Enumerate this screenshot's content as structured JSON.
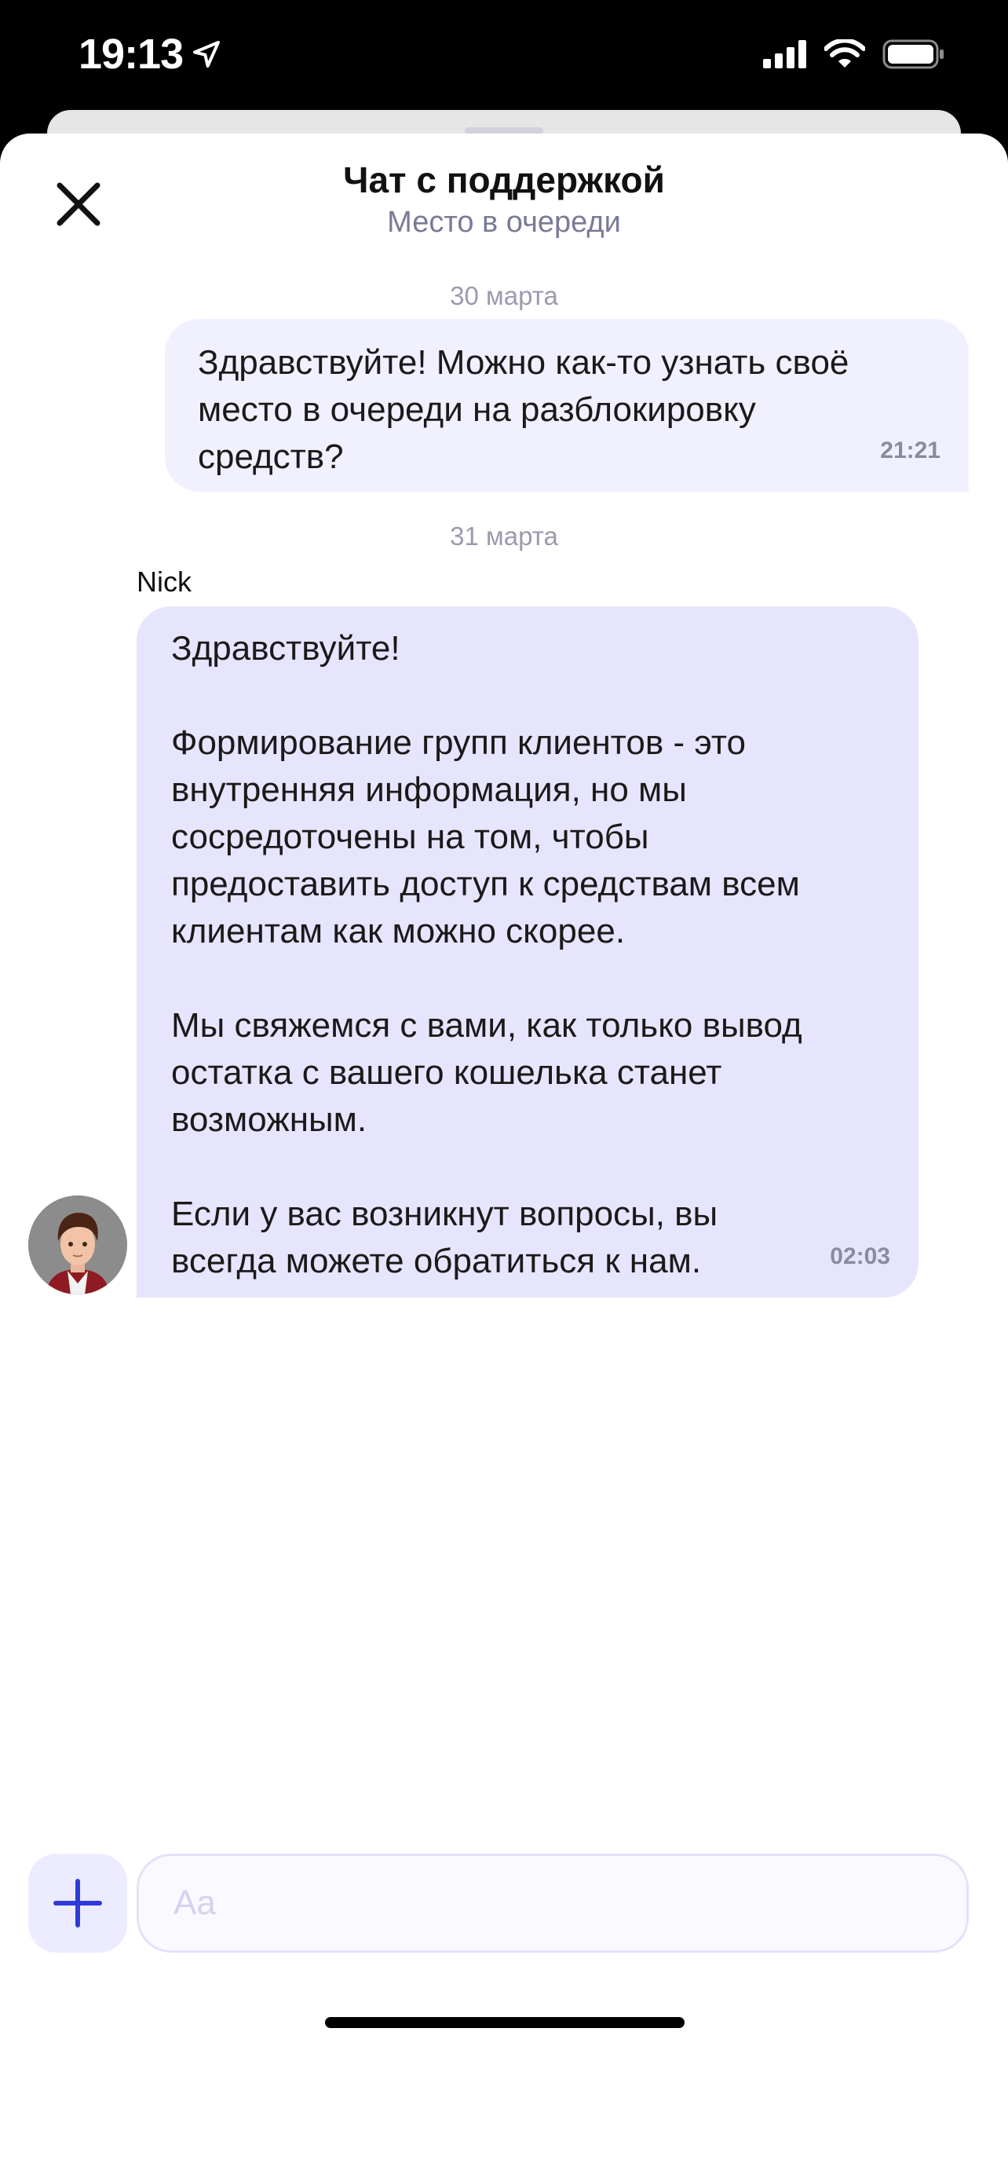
{
  "status_bar": {
    "time": "19:13"
  },
  "header": {
    "title": "Чат с поддержкой",
    "subtitle": "Место в очереди"
  },
  "messages": [
    {
      "date": "30 марта",
      "direction": "outgoing",
      "text": "Здравствуйте! Можно как-то узнать своё\nместо в очереди на разблокировку\nсредств?",
      "time": "21:21"
    },
    {
      "date": "31 марта",
      "direction": "incoming",
      "sender": "Nick",
      "text": "Здравствуйте!\n\nФормирование групп клиентов - это\nвнутренняя информация, но мы\nсосредоточены на том, чтобы\nпредоставить доступ к средствам всем\nклиентам как можно скорее.\n\nМы свяжемся с вами, как только вывод\nостатка с вашего кошелька станет\nвозможным.\n\nЕсли у вас возникнут вопросы, вы\nвсегда можете обратиться к нам.",
      "time": "02:03"
    }
  ],
  "composer": {
    "placeholder": "Aa",
    "value": ""
  },
  "colors": {
    "accent": "#2f3bd9",
    "outgoing_bubble": "#f1f0ff",
    "incoming_bubble": "#e6e5fd",
    "subtitle": "#7a7a96"
  },
  "icons": {
    "close": "close-icon",
    "add": "plus-icon",
    "location": "location-arrow-icon",
    "signal": "cellular-signal-icon",
    "wifi": "wifi-icon",
    "battery": "battery-icon"
  }
}
